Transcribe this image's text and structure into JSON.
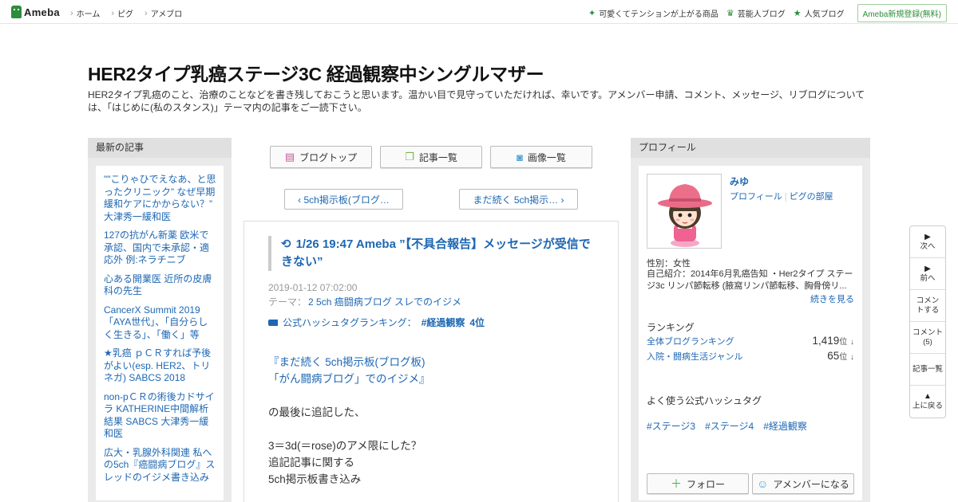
{
  "topbar": {
    "logo_text": "Ameba",
    "nav": [
      "ホーム",
      "ピグ",
      "アメブロ"
    ],
    "right_links": [
      {
        "label": "可愛くてテンションが上がる商品",
        "icon": "sparkle-icon"
      },
      {
        "label": "芸能人ブログ",
        "icon": "crown-icon"
      },
      {
        "label": "人気ブログ",
        "icon": "star-icon"
      }
    ],
    "register_label": "Ameba新規登録(無料)",
    "accent_color": "#2d8c3c"
  },
  "blog": {
    "title": "HER2タイプ乳癌ステージ3C 経過観察中シングルマザー",
    "description": "HER2タイプ乳癌のこと、治療のことなどを書き残しておこうと思います。温かい目で見守っていただければ、幸いです。アメンバー申請、コメント、メッセージ、リブログについては、「はじめに(私のスタンス)」テーマ内の記事をご一読下さい。"
  },
  "recent": {
    "heading": "最新の記事",
    "items": [
      "\"\"こりゃひでえなあ、と思ったクリニック” なぜ早期緩和ケアにかからない？” 大津秀一緩和医",
      "127の抗がん新薬 欧米で承認、国内で未承認・適応外 例:ネラチニブ",
      "心ある開業医 近所の皮膚科の先生",
      "CancerX Summit 2019 「AYA世代」、「自分らしく生きる」、「働く」等",
      "★乳癌 ｐＣＲすれば予後がよい(esp. HER2、トリネガ) SABCS 2018",
      "non-pＣＲの術後カドサイラ KATHERINE中間解析結果 SABCS 大津秀一緩和医",
      "広大・乳腺外科関連 私への5ch『癌闘病ブログ』スレッドのイジメ書き込み"
    ]
  },
  "nav_buttons": [
    {
      "label": "ブログトップ",
      "icon": "document-icon"
    },
    {
      "label": "記事一覧",
      "icon": "copy-icon"
    },
    {
      "label": "画像一覧",
      "icon": "camera-icon"
    }
  ],
  "pager": {
    "prev": "‹ 5ch掲示板(ブログ…",
    "next": "まだ続く 5ch掲示… ›"
  },
  "entry": {
    "reblog_icon": "reblog-icon",
    "title": "1/26 19:47 Ameba ”【不具合報告】メッセージが受信できない”",
    "date": "2019-01-12 07:02:00",
    "theme_label": "テーマ：",
    "theme_value": "2 5ch 癌闘病ブログ スレでのイジメ",
    "ranking_label": "公式ハッシュタグランキング：",
    "ranking_tag": "#経過観察",
    "ranking_pos": "4位",
    "body_link_1": "『まだ続く 5ch掲示板(ブログ板)",
    "body_link_2": "「がん闘病ブログ」でのイジメ』",
    "body_p1": "の最後に追記した、",
    "body_p2": "3＝3d(＝rose)のアメ限にした？",
    "body_p3": "追記記事に関する",
    "body_p4": "5ch掲示板書き込み"
  },
  "profile": {
    "heading": "プロフィール",
    "name": "みゆ",
    "link_profile": "プロフィール",
    "link_room": "ピグの部屋",
    "gender": "性別：女性",
    "intro": "自己紹介：2014年6月乳癌告知 ・Her2タイプ ステージ3c リンパ節転移 (腋窩リンパ節転移、胸骨傍リ...",
    "more": "続きを見る",
    "ranking_heading": "ランキング",
    "rankings": [
      {
        "label": "全体ブログランキング",
        "value": "1,419",
        "unit": "位",
        "trend": "↓"
      },
      {
        "label": "入院・闘病生活ジャンル",
        "value": "65",
        "unit": "位",
        "trend": "↓"
      }
    ],
    "tags_heading": "よく使う公式ハッシュタグ",
    "tags": [
      "#ステージ3",
      "#ステージ4",
      "#経過観察"
    ],
    "follow_label": "フォロー",
    "amember_label": "アメンバーになる"
  },
  "floatnav": [
    {
      "label": "次へ",
      "arrow": "▶"
    },
    {
      "label": "前へ",
      "arrow": "▶"
    },
    {
      "label": "コメントする",
      "arrow": ""
    },
    {
      "label": "コメント(5)",
      "arrow": ""
    },
    {
      "label": "記事一覧",
      "arrow": ""
    },
    {
      "label": "上に戻る",
      "arrow": "▲"
    }
  ]
}
